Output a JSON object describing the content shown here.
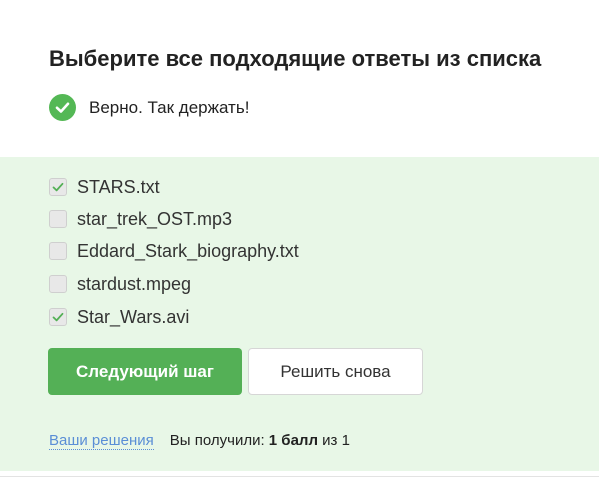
{
  "question": {
    "title": "Выберите все подходящие ответы из списка"
  },
  "feedback": {
    "icon": "check-circle-icon",
    "text": "Верно. Так держать!",
    "color": "#54b855"
  },
  "options": [
    {
      "label": "STARS.txt",
      "checked": true
    },
    {
      "label": "star_trek_OST.mp3",
      "checked": false
    },
    {
      "label": "Eddard_Stark_biography.txt",
      "checked": false
    },
    {
      "label": "stardust.mpeg",
      "checked": false
    },
    {
      "label": "Star_Wars.avi",
      "checked": true
    }
  ],
  "buttons": {
    "next_label": "Следующий шаг",
    "retry_label": "Решить снова"
  },
  "footer": {
    "solutions_link": "Ваши решения",
    "score_prefix": "Вы получили:",
    "score_value": "1 балл",
    "score_suffix": "из 1"
  },
  "colors": {
    "accent_green": "#54b056",
    "panel_background": "#e8f7e7",
    "link": "#5a8ed6"
  }
}
